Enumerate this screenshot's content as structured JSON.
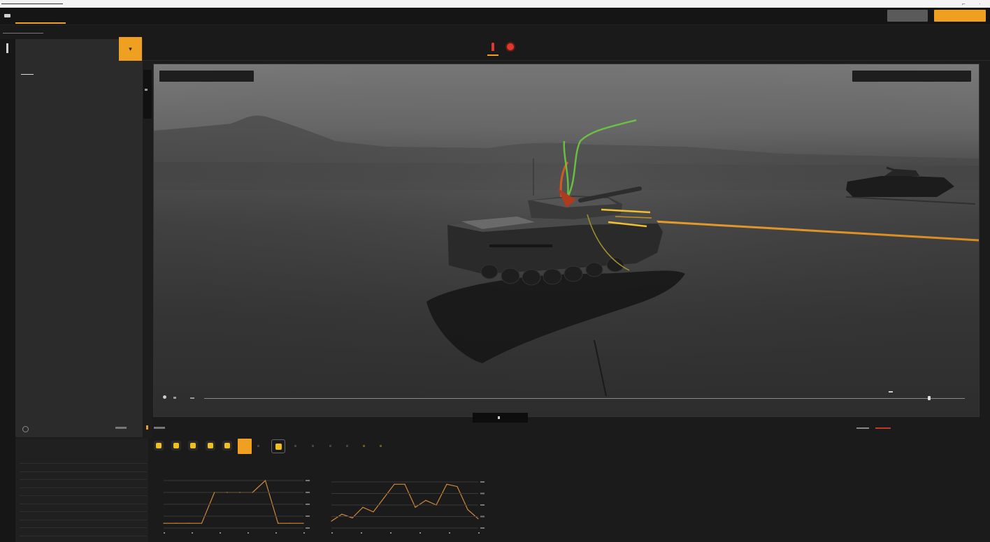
{
  "colors": {
    "accent": "#f0a020",
    "record": "#e0392b",
    "laser": "#f0a030",
    "plume": "#6fcf3f"
  },
  "titlebar": {
    "active_tab": "",
    "secondary_button": "",
    "primary_button": ""
  },
  "breadcrumb": "",
  "left_panel": {
    "title": "",
    "subtitle": "",
    "tabs": [
      "",
      "",
      "",
      ""
    ],
    "items": [
      {
        "label": "",
        "sub": ""
      },
      {
        "label": "",
        "sub": ""
      },
      {
        "label": "",
        "sub": ""
      },
      {
        "label": "",
        "sub": ""
      },
      {
        "label": "",
        "sub": ""
      }
    ]
  },
  "viewport": {
    "overlay_left": "",
    "overlay_right": "",
    "icons": [
      "marker-icon",
      "record-icon"
    ]
  },
  "status_right": "",
  "bottom_table": {
    "title": "",
    "rows": [
      [
        "",
        "",
        "",
        "",
        ""
      ],
      [
        "",
        "",
        "",
        "",
        ""
      ],
      [
        "",
        "",
        "",
        "",
        ""
      ],
      [
        "",
        "",
        "",
        "",
        ""
      ],
      [
        "",
        "",
        "",
        "",
        ""
      ],
      [
        "",
        "",
        "",
        "",
        ""
      ],
      [
        "",
        "",
        "",
        "",
        ""
      ],
      [
        "",
        "",
        "",
        "",
        ""
      ],
      [
        "",
        "",
        "",
        "",
        ""
      ],
      [
        "",
        "",
        "",
        "",
        ""
      ]
    ]
  },
  "charts": {
    "chart1": {
      "title": ""
    },
    "chart2": {
      "title": "",
      "subtitle": ""
    }
  },
  "summary": {
    "title": "",
    "value": ""
  },
  "chart_data": [
    {
      "type": "line",
      "title": "",
      "x": [
        0,
        1,
        2,
        3,
        4,
        5,
        6,
        7,
        8,
        9,
        10,
        11
      ],
      "values": [
        0.1,
        0.1,
        0.1,
        0.1,
        0.75,
        0.75,
        0.75,
        0.75,
        1.0,
        0.1,
        0.1,
        0.1
      ]
    },
    {
      "type": "line",
      "title": "",
      "x": [
        0,
        1,
        2,
        3,
        4,
        5,
        6,
        7,
        8,
        9,
        10,
        11,
        12,
        13,
        14
      ],
      "values": [
        0.15,
        0.3,
        0.22,
        0.45,
        0.35,
        0.65,
        0.95,
        0.95,
        0.45,
        0.6,
        0.5,
        0.95,
        0.9,
        0.4,
        0.2
      ]
    }
  ]
}
